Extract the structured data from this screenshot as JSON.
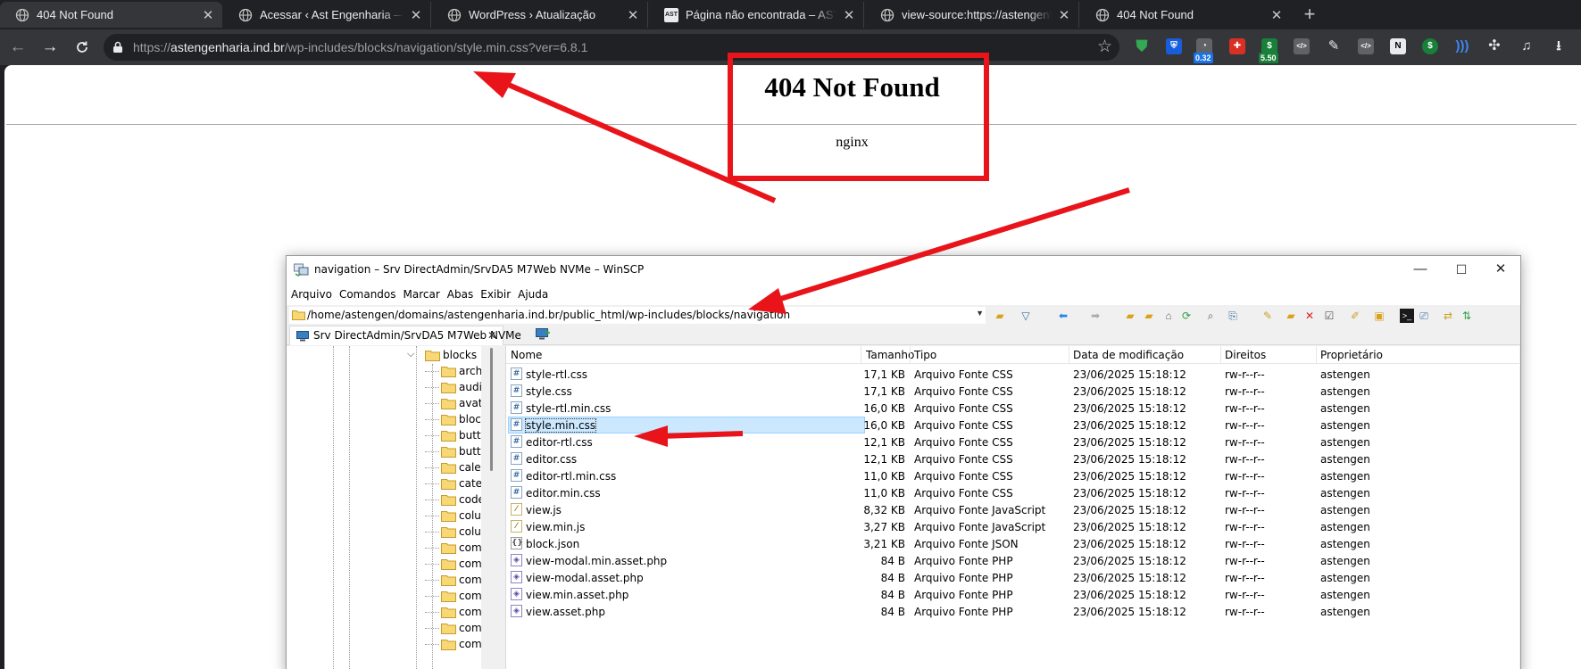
{
  "browser": {
    "tabs": [
      {
        "title": "404 Not Found",
        "active": true
      },
      {
        "title": "Acessar ‹ Ast Engenharia — WordPress",
        "active": false
      },
      {
        "title": "WordPress › Atualização",
        "active": false
      },
      {
        "title": "Página não encontrada – AST",
        "active": false
      },
      {
        "title": "view-source:https://astengenharia.ind.br",
        "active": false
      },
      {
        "title": "404 Not Found",
        "active": false
      }
    ],
    "url": {
      "scheme": "https://",
      "host": "astengenharia.ind.br",
      "path": "/wp-includes/blocks/navigation/style.min.css?ver=6.8.1"
    },
    "ext_badges": [
      "0.32",
      "5.50"
    ],
    "ext_icons": [
      "shield-icon",
      "bitwarden-icon",
      "meter-icon",
      "flag-icon",
      "dollar-icon",
      "code-icon",
      "eyedropper-icon",
      "source-icon",
      "notion-icon",
      "money-icon",
      "sound-icon",
      "puzzle-icon",
      "media-icon",
      "menu-icon"
    ]
  },
  "page": {
    "title": "404 Not Found",
    "server": "nginx"
  },
  "winscp": {
    "title": "navigation – Srv DirectAdmin/SrvDA5 M7Web NVMe – WinSCP",
    "menu": [
      "Arquivo",
      "Comandos",
      "Marcar",
      "Abas",
      "Exibir",
      "Ajuda"
    ],
    "path": "/home/astengen/domains/astengenharia.ind.br/public_html/wp-includes/blocks/navigation",
    "session_tab": "Srv DirectAdmin/SrvDA5 M7Web NVMe",
    "tree": {
      "root": "blocks",
      "children": [
        "archi",
        "audic",
        "avata",
        "block",
        "butto",
        "butto",
        "calen",
        "categ",
        "code",
        "colur",
        "colur",
        "comr",
        "comr",
        "comr",
        "comr",
        "comr",
        "comr",
        "comr"
      ]
    },
    "columns": [
      "Nome",
      "Tamanho",
      "Tipo",
      "Data de modificação",
      "Direitos",
      "Proprietário"
    ],
    "files": [
      {
        "name": "style-rtl.css",
        "size": "17,1 KB",
        "type": "Arquivo Fonte CSS",
        "modified": "23/06/2025 15:18:12",
        "rights": "rw-r--r--",
        "owner": "astengen",
        "icon": "css"
      },
      {
        "name": "style.css",
        "size": "17,1 KB",
        "type": "Arquivo Fonte CSS",
        "modified": "23/06/2025 15:18:12",
        "rights": "rw-r--r--",
        "owner": "astengen",
        "icon": "css"
      },
      {
        "name": "style-rtl.min.css",
        "size": "16,0 KB",
        "type": "Arquivo Fonte CSS",
        "modified": "23/06/2025 15:18:12",
        "rights": "rw-r--r--",
        "owner": "astengen",
        "icon": "css"
      },
      {
        "name": "style.min.css",
        "size": "16,0 KB",
        "type": "Arquivo Fonte CSS",
        "modified": "23/06/2025 15:18:12",
        "rights": "rw-r--r--",
        "owner": "astengen",
        "icon": "css",
        "selected": true
      },
      {
        "name": "editor-rtl.css",
        "size": "12,1 KB",
        "type": "Arquivo Fonte CSS",
        "modified": "23/06/2025 15:18:12",
        "rights": "rw-r--r--",
        "owner": "astengen",
        "icon": "css"
      },
      {
        "name": "editor.css",
        "size": "12,1 KB",
        "type": "Arquivo Fonte CSS",
        "modified": "23/06/2025 15:18:12",
        "rights": "rw-r--r--",
        "owner": "astengen",
        "icon": "css"
      },
      {
        "name": "editor-rtl.min.css",
        "size": "11,0 KB",
        "type": "Arquivo Fonte CSS",
        "modified": "23/06/2025 15:18:12",
        "rights": "rw-r--r--",
        "owner": "astengen",
        "icon": "css"
      },
      {
        "name": "editor.min.css",
        "size": "11,0 KB",
        "type": "Arquivo Fonte CSS",
        "modified": "23/06/2025 15:18:12",
        "rights": "rw-r--r--",
        "owner": "astengen",
        "icon": "css"
      },
      {
        "name": "view.js",
        "size": "8,32 KB",
        "type": "Arquivo Fonte JavaScript",
        "modified": "23/06/2025 15:18:12",
        "rights": "rw-r--r--",
        "owner": "astengen",
        "icon": "js"
      },
      {
        "name": "view.min.js",
        "size": "3,27 KB",
        "type": "Arquivo Fonte JavaScript",
        "modified": "23/06/2025 15:18:12",
        "rights": "rw-r--r--",
        "owner": "astengen",
        "icon": "js"
      },
      {
        "name": "block.json",
        "size": "3,21 KB",
        "type": "Arquivo Fonte JSON",
        "modified": "23/06/2025 15:18:12",
        "rights": "rw-r--r--",
        "owner": "astengen",
        "icon": "json"
      },
      {
        "name": "view-modal.min.asset.php",
        "size": "84 B",
        "type": "Arquivo Fonte PHP",
        "modified": "23/06/2025 15:18:12",
        "rights": "rw-r--r--",
        "owner": "astengen",
        "icon": "php"
      },
      {
        "name": "view-modal.asset.php",
        "size": "84 B",
        "type": "Arquivo Fonte PHP",
        "modified": "23/06/2025 15:18:12",
        "rights": "rw-r--r--",
        "owner": "astengen",
        "icon": "php"
      },
      {
        "name": "view.min.asset.php",
        "size": "84 B",
        "type": "Arquivo Fonte PHP",
        "modified": "23/06/2025 15:18:12",
        "rights": "rw-r--r--",
        "owner": "astengen",
        "icon": "php"
      },
      {
        "name": "view.asset.php",
        "size": "84 B",
        "type": "Arquivo Fonte PHP",
        "modified": "23/06/2025 15:18:12",
        "rights": "rw-r--r--",
        "owner": "astengen",
        "icon": "php"
      }
    ]
  },
  "colors": {
    "annotation": "#e8141a",
    "selection": "#cce8ff",
    "chrome_dark": "#202124"
  }
}
